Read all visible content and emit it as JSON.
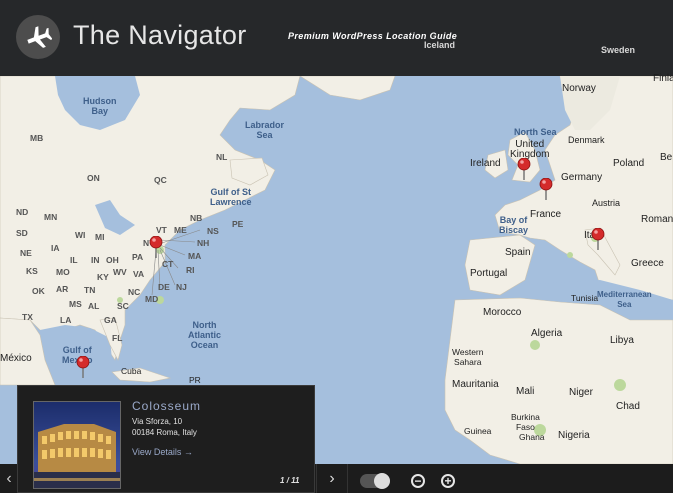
{
  "header": {
    "brand": "The Navigator",
    "tagline": "Premium WordPress Location Guide",
    "labels": [
      "Sweden",
      "Iceland"
    ]
  },
  "map": {
    "water_labels": {
      "hudson_bay": "Hudson\nBay",
      "labrador_sea": "Labrador\nSea",
      "gulf_st_lawrence": "Gulf of St\nLawrence",
      "north_atlantic": "North\nAtlantic\nOcean",
      "north_sea": "North Sea",
      "bay_of_biscay": "Bay of\nBiscay",
      "gulf_of_mexico": "Gulf of\nMexico",
      "mediterranean": "Mediterranean\nSea"
    },
    "country_labels": {
      "norway": "Norway",
      "finland": "Finla",
      "denmark": "Denmark",
      "uk": "United\nKingdom",
      "ireland": "Ireland",
      "poland": "Poland",
      "germany": "Germany",
      "austria": "Austria",
      "france": "France",
      "italy": "Italy",
      "spain": "Spain",
      "portugal": "Portugal",
      "romania": "Roman",
      "greece": "Greece",
      "tunisia": "Tunisia",
      "morocco": "Morocco",
      "algeria": "Algeria",
      "libya": "Libya",
      "western_sahara": "Western\nSahara",
      "mauritania": "Mauritania",
      "mali": "Mali",
      "niger": "Niger",
      "chad": "Chad",
      "burkina": "Burkina\nFaso",
      "guinea": "Guinea",
      "ghana": "Ghana",
      "nigeria": "Nigeria",
      "mexico": "México",
      "cuba": "Cuba",
      "pr": "PR",
      "belarus": "Be"
    },
    "state_labels": [
      "MB",
      "ON",
      "QC",
      "NL",
      "ND",
      "MN",
      "SD",
      "NE",
      "KS",
      "OK",
      "TX",
      "IA",
      "MO",
      "AR",
      "LA",
      "MS",
      "AL",
      "TN",
      "KY",
      "IL",
      "IN",
      "OH",
      "WI",
      "MI",
      "WV",
      "VA",
      "NC",
      "SC",
      "GA",
      "FL",
      "PA",
      "NY",
      "VT",
      "NH",
      "ME",
      "MA",
      "CT",
      "RI",
      "NJ",
      "DE",
      "MD",
      "NB",
      "NS",
      "PE"
    ]
  },
  "infobox": {
    "title": "Colosseum",
    "address_line1": "Via Sforza, 10",
    "address_line2": "00184 Roma, Italy",
    "link": "View Details →",
    "page": "1 / 11"
  },
  "bottombar": {
    "prev": "‹",
    "next": "›",
    "zoom_out": "−",
    "zoom_in": "+"
  }
}
